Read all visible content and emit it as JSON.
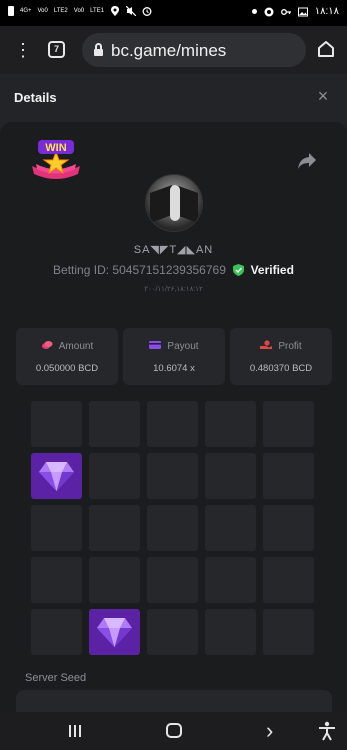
{
  "status_bar": {
    "network_labels": [
      "4G+",
      "Vo0",
      "LTE2",
      "Vo0",
      "LTE1"
    ],
    "time": "۱۸:۱۸"
  },
  "browser": {
    "url": "bc.game/mines",
    "tab_count": "7"
  },
  "details": {
    "title": "Details",
    "badge_text": "WIN",
    "username": "SA◥◤T◢◣AN",
    "betting_label": "Betting ID:",
    "betting_id": "504571512393567​69",
    "verified_label": "Verified",
    "timestamp": "۲۰۰/۱۱/۲۶,۱۸:۱۸:۱۲"
  },
  "stats": [
    {
      "label": "Amount",
      "value": "0.050000 BCD",
      "icon": "coins-icon",
      "color": "#e2406a"
    },
    {
      "label": "Payout",
      "value": "10.6074 x",
      "icon": "card-icon",
      "color": "#8a4ee8"
    },
    {
      "label": "Profit",
      "value": "0.480370 BCD",
      "icon": "hand-coins-icon",
      "color": "#e04848"
    }
  ],
  "mines_grid": {
    "rows": 5,
    "cols": 5,
    "gem_tiles": [
      [
        1,
        0
      ],
      [
        4,
        1
      ]
    ],
    "gem_color": "#5b22a6"
  },
  "seed": {
    "label": "Server Seed"
  },
  "colors": {
    "page_bg": "#232427",
    "card_bg": "#1b1c1e",
    "tile_bg": "#26272b",
    "verified_green": "#3bc15a"
  }
}
